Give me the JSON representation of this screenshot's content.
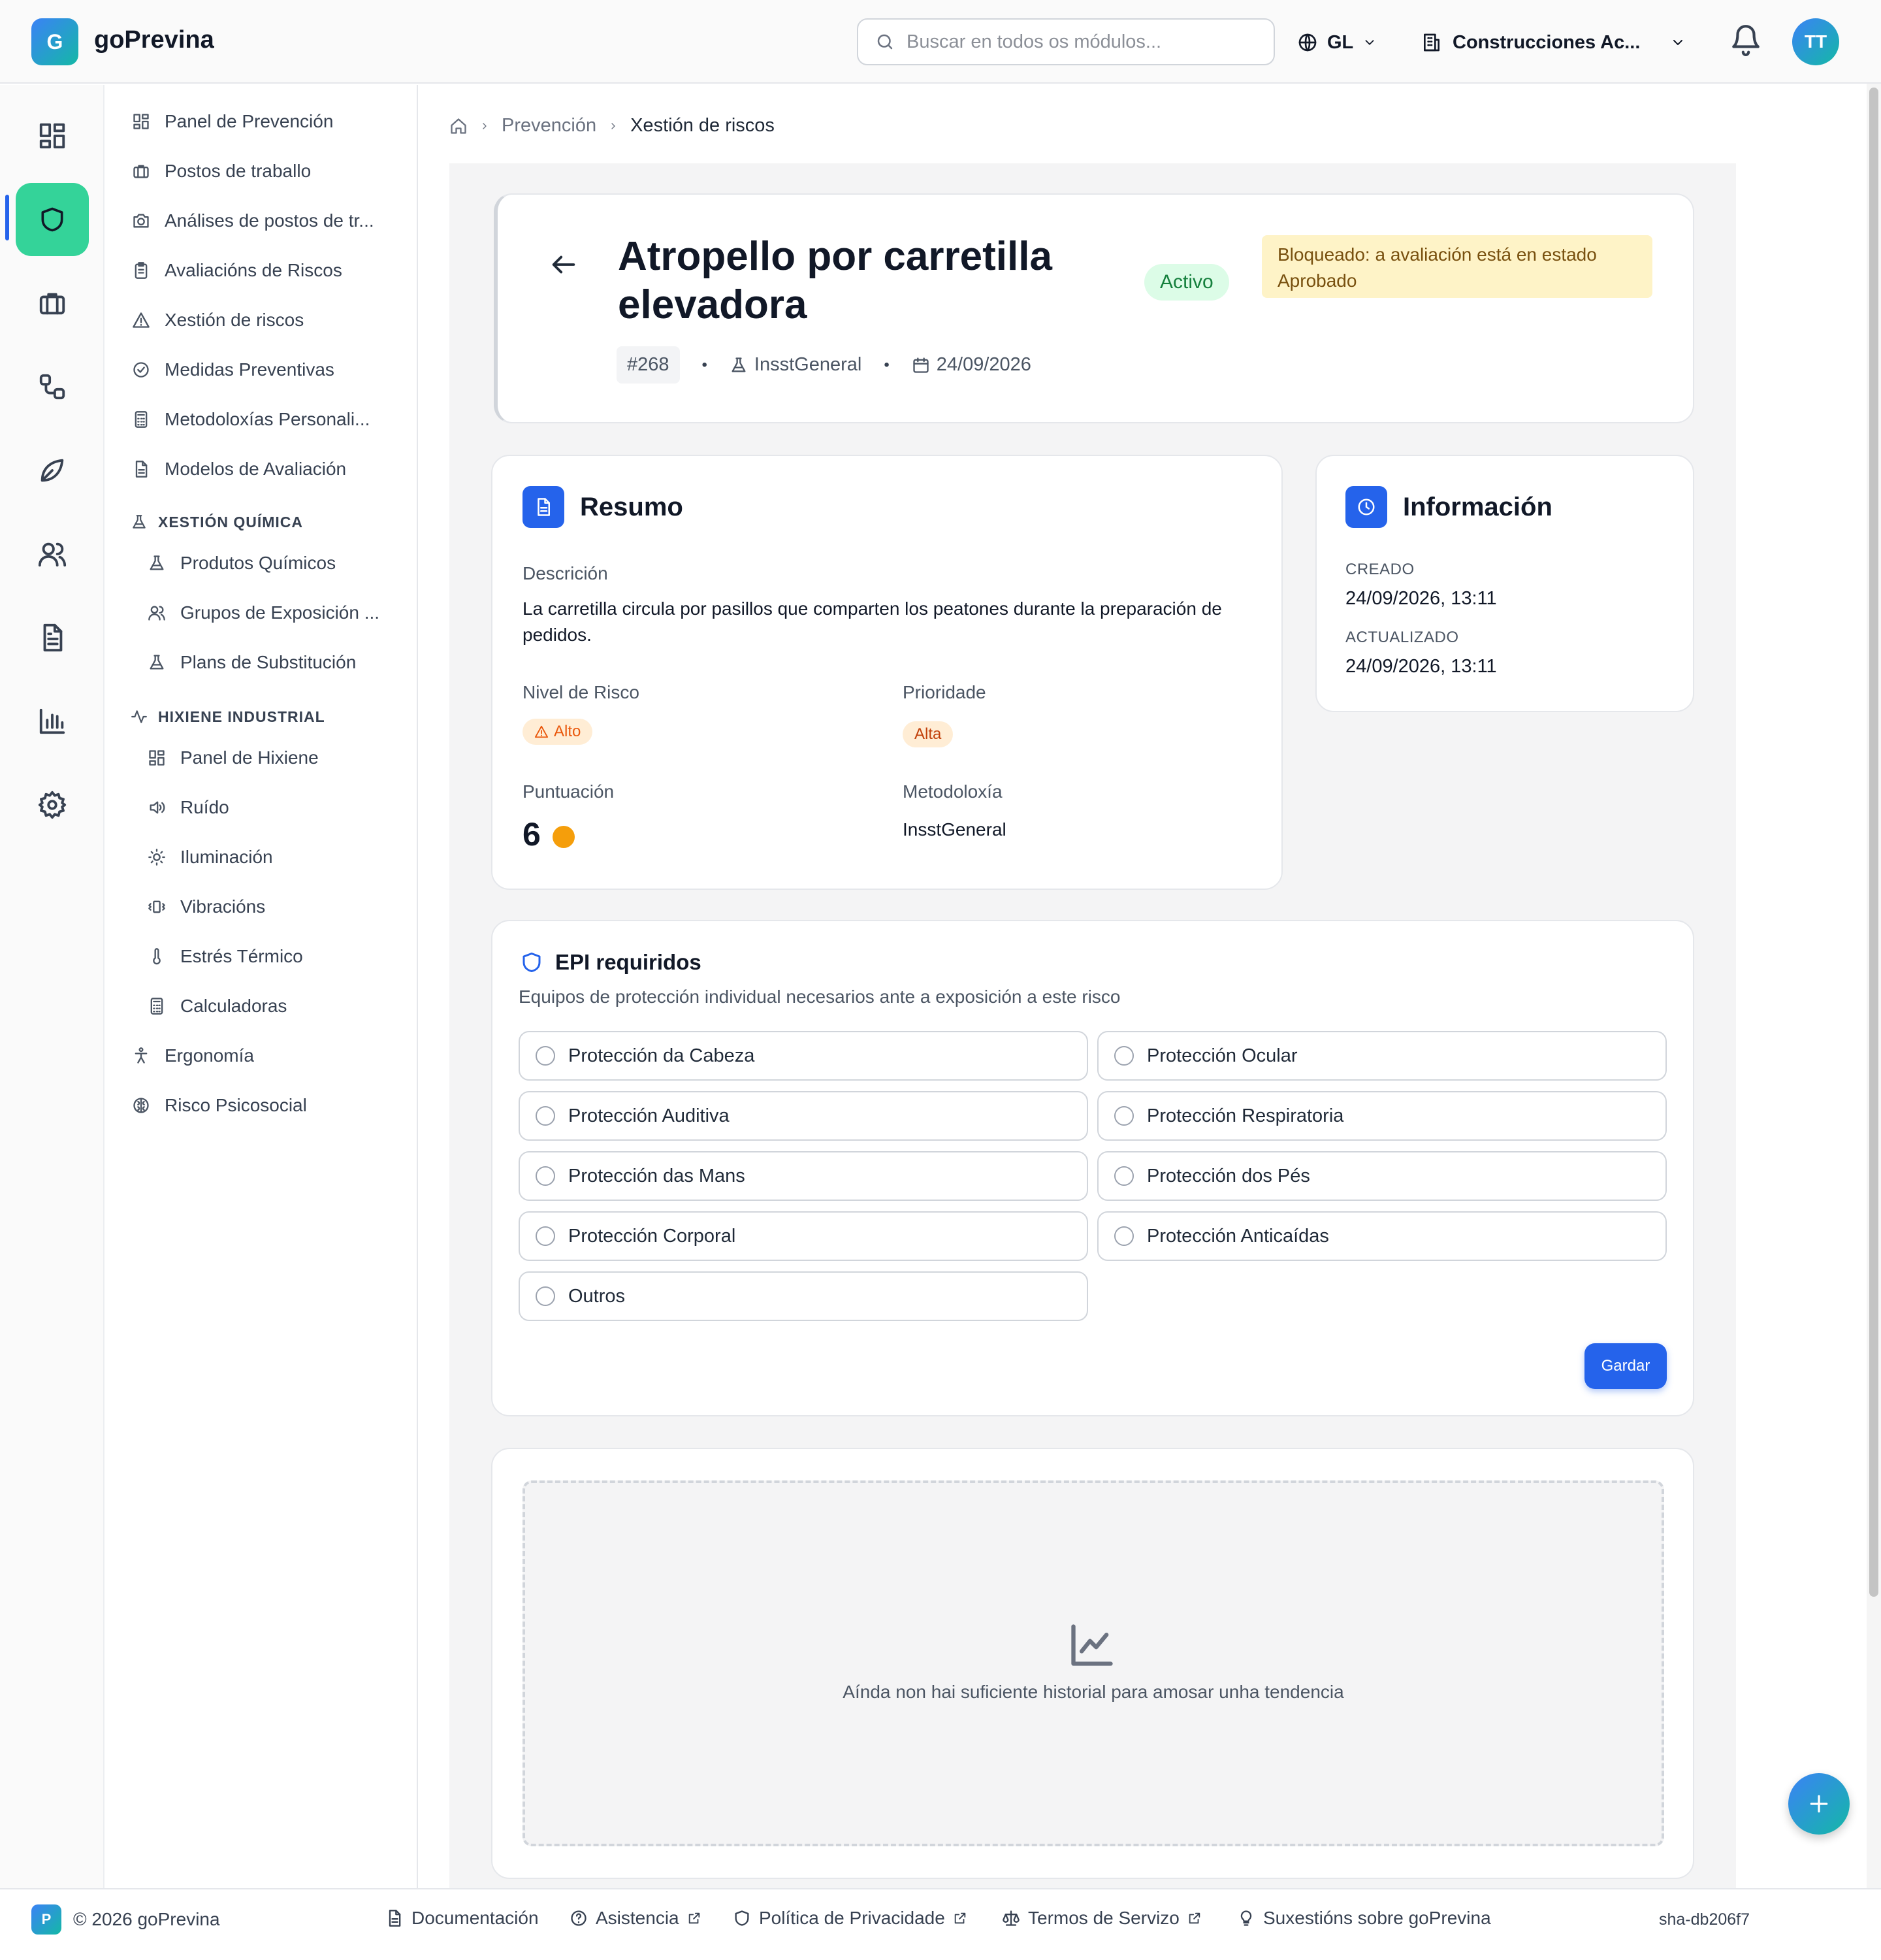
{
  "app": {
    "name": "goPrevina",
    "logo_letter": "G"
  },
  "header": {
    "search_placeholder": "Buscar en todos os módulos...",
    "language": "GL",
    "organization": "Construcciones Ac...",
    "avatar_initials": "TT"
  },
  "rail": {
    "icons": [
      "dashboard-icon",
      "shield-icon",
      "briefcase-icon",
      "workflow-icon",
      "leaf-icon",
      "users-icon",
      "document-icon",
      "bar-chart-icon",
      "settings-icon"
    ],
    "active_index": 1
  },
  "sidebar": {
    "items": [
      {
        "label": "Panel de Prevención",
        "icon": "layout-icon"
      },
      {
        "label": "Postos de traballo",
        "icon": "building-icon"
      },
      {
        "label": "Análises de postos de tr...",
        "icon": "camera-icon"
      },
      {
        "label": "Avaliacións de Riscos",
        "icon": "clipboard-icon"
      },
      {
        "label": "Xestión de riscos",
        "icon": "warning-icon"
      },
      {
        "label": "Medidas Preventivas",
        "icon": "check-circle-icon"
      },
      {
        "label": "Metodoloxías Personali...",
        "icon": "calculator-icon"
      },
      {
        "label": "Modelos de Avaliación",
        "icon": "file-icon"
      }
    ],
    "section_quimica": {
      "title": "XESTIÓN QUÍMICA",
      "items": [
        {
          "label": "Produtos Químicos",
          "icon": "flask-icon"
        },
        {
          "label": "Grupos de Exposición ...",
          "icon": "users-icon"
        },
        {
          "label": "Plans de Substitución",
          "icon": "flask-icon"
        }
      ]
    },
    "section_hixiene": {
      "title": "HIXIENE INDUSTRIAL",
      "items": [
        {
          "label": "Panel de Hixiene",
          "icon": "layout-icon"
        },
        {
          "label": "Ruído",
          "icon": "speaker-icon"
        },
        {
          "label": "Iluminación",
          "icon": "sun-icon"
        },
        {
          "label": "Vibracións",
          "icon": "vibration-icon"
        },
        {
          "label": "Estrés Térmico",
          "icon": "thermometer-icon"
        },
        {
          "label": "Calculadoras",
          "icon": "calculator-icon"
        }
      ]
    },
    "bottom_items": [
      {
        "label": "Ergonomía",
        "icon": "person-icon"
      },
      {
        "label": "Risco Psicosocial",
        "icon": "brain-icon"
      }
    ]
  },
  "breadcrumb": {
    "items": [
      "Prevención",
      "Xestión de riscos"
    ]
  },
  "risk": {
    "title": "Atropello por carretilla elevadora",
    "status": "Activo",
    "lock_notice": "Bloqueado: a avaliación está en estado Aprobado",
    "id": "#268",
    "methodology": "InsstGeneral",
    "date": "24/09/2026"
  },
  "resumo": {
    "title": "Resumo",
    "description_label": "Descrición",
    "description": "La carretilla circula por pasillos que comparten los peatones durante la preparación de pedidos.",
    "risk_level_label": "Nivel de Risco",
    "risk_level": "Alto",
    "priority_label": "Prioridade",
    "priority": "Alta",
    "score_label": "Puntuación",
    "score": "6",
    "score_color": "#f59e0b",
    "methodology_label": "Metodoloxía",
    "methodology": "InsstGeneral"
  },
  "info": {
    "title": "Información",
    "created_label": "CREADO",
    "created": "24/09/2026, 13:11",
    "updated_label": "ACTUALIZADO",
    "updated": "24/09/2026, 13:11"
  },
  "epi": {
    "title": "EPI requiridos",
    "subtitle": "Equipos de protección individual necesarios ante a exposición a este risco",
    "options": [
      "Protección da Cabeza",
      "Protección Ocular",
      "Protección Auditiva",
      "Protección Respiratoria",
      "Protección das Mans",
      "Protección dos Pés",
      "Protección Corporal",
      "Protección Anticaídas",
      "Outros"
    ],
    "save_label": "Gardar"
  },
  "trend": {
    "empty_message": "Aínda non hai suficiente historial para amosar unha tendencia"
  },
  "footer": {
    "logo_letter": "P",
    "copyright": "© 2026 goPrevina",
    "links": [
      "Documentación",
      "Asistencia",
      "Política de Privacidade",
      "Termos de Servizo",
      "Suxestións sobre goPrevina"
    ],
    "version": "sha-db206f7"
  },
  "colors": {
    "accent": "#2563eb",
    "active_rail": "#34d399",
    "status_active_bg": "#dcfce7",
    "warning_bg": "#fef3c7",
    "risk_alto": "#ea580c"
  }
}
